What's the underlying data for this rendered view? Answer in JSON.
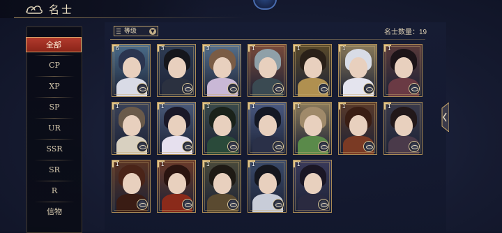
{
  "header": {
    "title": "名士"
  },
  "sidebar": {
    "items": [
      {
        "label": "全部",
        "active": true
      },
      {
        "label": "CP",
        "active": false
      },
      {
        "label": "XP",
        "active": false
      },
      {
        "label": "SP",
        "active": false
      },
      {
        "label": "UR",
        "active": false
      },
      {
        "label": "SSR",
        "active": false
      },
      {
        "label": "SR",
        "active": false
      },
      {
        "label": "R",
        "active": false
      },
      {
        "label": "信物",
        "active": false
      }
    ]
  },
  "toolbar": {
    "sort_label": "等级",
    "count_label": "名士数量：",
    "count_value": "19"
  },
  "cards": [
    {
      "level": "6",
      "hair": "#2b3550",
      "robe": "#d9dbe6",
      "bg": "#4b6d8a"
    },
    {
      "level": "3",
      "hair": "#15161c",
      "robe": "#2b3140",
      "bg": "#2f3d55"
    },
    {
      "level": "3",
      "hair": "#7a5c45",
      "robe": "#c9b8d6",
      "bg": "#56708c"
    },
    {
      "level": "1",
      "hair": "#8fa0a8",
      "robe": "#3a4a52",
      "bg": "#7a4a3a"
    },
    {
      "level": "1",
      "hair": "#2a2018",
      "robe": "#b09050",
      "bg": "#5a4a2a"
    },
    {
      "level": "1",
      "hair": "#d8dce6",
      "robe": "#e4e4ee",
      "bg": "#8a7a5a"
    },
    {
      "level": "1",
      "hair": "#1c1418",
      "robe": "#6a3a44",
      "bg": "#5a3a3a"
    },
    {
      "level": "1",
      "hair": "#6a5a4a",
      "robe": "#d8d0c0",
      "bg": "#3a4258"
    },
    {
      "level": "1",
      "hair": "#1a1828",
      "robe": "#e6e0ee",
      "bg": "#4a5a7a"
    },
    {
      "level": "1",
      "hair": "#1a221a",
      "robe": "#2a4a3a",
      "bg": "#3a4a4a"
    },
    {
      "level": "1",
      "hair": "#141824",
      "robe": "#2a3048",
      "bg": "#4a5a82"
    },
    {
      "level": "1",
      "hair": "#a08a6a",
      "robe": "#5a8a4a",
      "bg": "#8a7a5a"
    },
    {
      "level": "1",
      "hair": "#3a1e14",
      "robe": "#7a3a24",
      "bg": "#5a3a2a"
    },
    {
      "level": "1",
      "hair": "#22181a",
      "robe": "#4a3a4a",
      "bg": "#3a3a4a"
    },
    {
      "level": "1",
      "hair": "#4a2418",
      "robe": "#3a1c14",
      "bg": "#5a3424"
    },
    {
      "level": "1",
      "hair": "#2a1410",
      "robe": "#8a2a1a",
      "bg": "#6a3a2a"
    },
    {
      "level": "1",
      "hair": "#1e1a14",
      "robe": "#5a4a30",
      "bg": "#4a4a3a"
    },
    {
      "level": "1",
      "hair": "#14161e",
      "robe": "#c8ccd8",
      "bg": "#3a4a6a"
    },
    {
      "level": "1",
      "hair": "#1a1624",
      "robe": "#2a2a40",
      "bg": "#3a3a5a"
    }
  ]
}
